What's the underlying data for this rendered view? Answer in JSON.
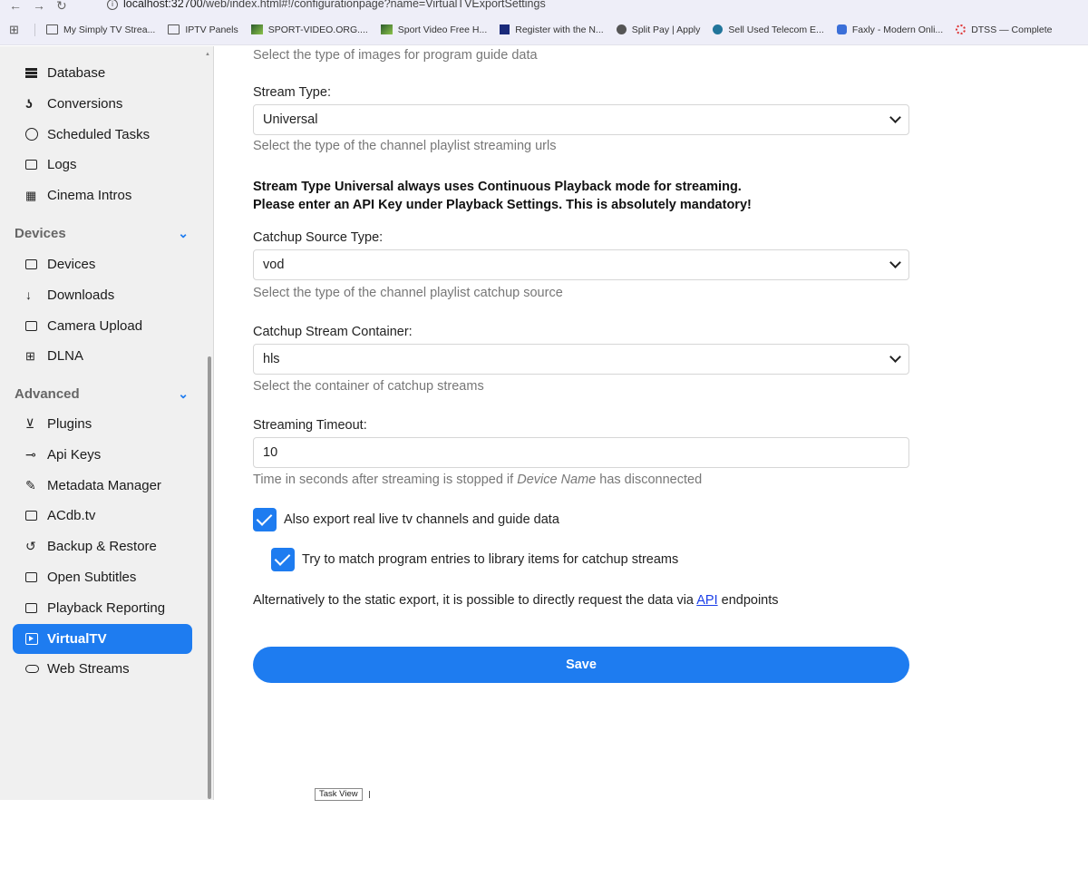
{
  "browser": {
    "url_host": "localhost:32700",
    "url_path": "/web/index.html#!/configurationpage?name=VirtualTVExportSettings",
    "bookmarks": [
      {
        "label": "My Simply TV Strea...",
        "icon": "folder"
      },
      {
        "label": "IPTV Panels",
        "icon": "folder"
      },
      {
        "label": "SPORT-VIDEO.ORG....",
        "icon": "img"
      },
      {
        "label": "Sport Video Free H...",
        "icon": "img"
      },
      {
        "label": "Register with the N...",
        "icon": "sq"
      },
      {
        "label": "Split Pay | Apply",
        "icon": "round"
      },
      {
        "label": "Sell Used Telecom E...",
        "icon": "wp"
      },
      {
        "label": "Faxly - Modern Onli...",
        "icon": "fx"
      },
      {
        "label": "DTSS — Complete",
        "icon": "dt"
      }
    ]
  },
  "sidebar": {
    "items_top": [
      {
        "label": "Database",
        "icon": "database-icon"
      },
      {
        "label": "Conversions",
        "icon": "conversions-icon"
      },
      {
        "label": "Scheduled Tasks",
        "icon": "clock-icon"
      },
      {
        "label": "Logs",
        "icon": "folder-open-icon"
      },
      {
        "label": "Cinema Intros",
        "icon": "film-icon"
      }
    ],
    "devices_header": "Devices",
    "devices_items": [
      {
        "label": "Devices",
        "icon": "devices-icon"
      },
      {
        "label": "Downloads",
        "icon": "download-arrow-icon"
      },
      {
        "label": "Camera Upload",
        "icon": "camera-icon"
      },
      {
        "label": "DLNA",
        "icon": "dlna-icon"
      }
    ],
    "advanced_header": "Advanced",
    "advanced_items": [
      {
        "label": "Plugins",
        "icon": "cart-icon"
      },
      {
        "label": "Api Keys",
        "icon": "key-icon"
      },
      {
        "label": "Metadata Manager",
        "icon": "pencil-icon"
      },
      {
        "label": "ACdb.tv",
        "icon": "copy-icon"
      },
      {
        "label": "Backup & Restore",
        "icon": "restore-icon"
      },
      {
        "label": "Open Subtitles",
        "icon": "subtitles-icon"
      },
      {
        "label": "Playback Reporting",
        "icon": "folder-icon"
      },
      {
        "label": "VirtualTV",
        "icon": "play-box-icon",
        "active": true
      },
      {
        "label": "Web Streams",
        "icon": "cloud-icon"
      }
    ]
  },
  "form": {
    "image_type_desc": "Select the type of images for program guide data",
    "stream_type_label": "Stream Type:",
    "stream_type_value": "Universal",
    "stream_type_desc": "Select the type of the channel playlist streaming urls",
    "warning_line1": "Stream Type Universal always uses Continuous Playback mode for streaming.",
    "warning_line2": "Please enter an API Key under Playback Settings. This is absolutely mandatory!",
    "catchup_source_label": "Catchup Source Type:",
    "catchup_source_value": "vod",
    "catchup_source_desc": "Select the type of the channel playlist catchup source",
    "catchup_container_label": "Catchup Stream Container:",
    "catchup_container_value": "hls",
    "catchup_container_desc": "Select the container of catchup streams",
    "timeout_label": "Streaming Timeout:",
    "timeout_value": "10",
    "timeout_desc_pre": "Time in seconds after streaming is stopped if ",
    "timeout_desc_em": "Device Name",
    "timeout_desc_post": " has disconnected",
    "export_live_label": "Also export real live tv channels and guide data",
    "match_entries_label": "Try to match program entries to library items for catchup streams",
    "alt_text_pre": "Alternatively to the static export, it is possible to directly request the data via ",
    "alt_link": "API",
    "alt_text_post": " endpoints",
    "save_label": "Save"
  },
  "taskbar": {
    "tooltip": "Task View"
  }
}
